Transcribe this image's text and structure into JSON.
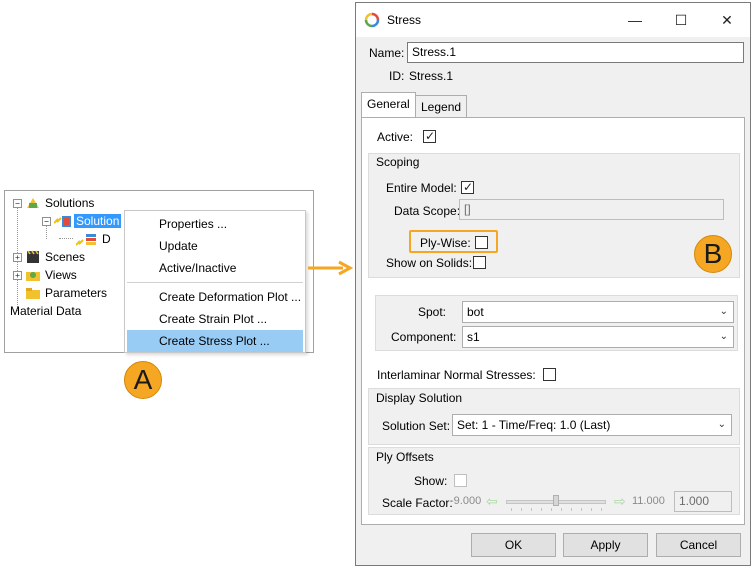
{
  "tree": {
    "items": [
      {
        "label": "Solutions",
        "icon": "solutions-icon"
      },
      {
        "label": "Solution",
        "icon": "solution-icon"
      },
      {
        "label": "D",
        "icon": "deformation-icon"
      },
      {
        "label": "Scenes",
        "icon": "scenes-icon"
      },
      {
        "label": "Views",
        "icon": "views-icon"
      },
      {
        "label": "Parameters",
        "icon": "parameters-icon"
      },
      {
        "label": "Material Data"
      }
    ]
  },
  "context_menu": {
    "items": [
      "Properties ...",
      "Update",
      "Active/Inactive",
      "Create Deformation Plot ...",
      "Create Strain Plot ...",
      "Create Stress Plot ..."
    ]
  },
  "callouts": {
    "a": "A",
    "b": "B"
  },
  "dialog": {
    "title": "Stress",
    "title_icon": "stress-app-icon",
    "window_controls": {
      "minimize": "—",
      "maximize": "☐",
      "close": "✕"
    },
    "name_label": "Name:",
    "name_value": "Stress.1",
    "id_label": "ID:",
    "id_value": "Stress.1",
    "tabs": [
      "General",
      "Legend"
    ],
    "active_label": "Active:",
    "active_checked": true,
    "scoping": {
      "title": "Scoping",
      "entire_model_label": "Entire Model:",
      "entire_model_checked": true,
      "data_scope_label": "Data Scope:",
      "data_scope_value": "[]",
      "ply_wise_label": "Ply-Wise:",
      "ply_wise_checked": false,
      "show_on_solids_label": "Show on Solids:",
      "show_on_solids_checked": false
    },
    "spot_label": "Spot:",
    "spot_value": "bot",
    "component_label": "Component:",
    "component_value": "s1",
    "interlaminar_label": "Interlaminar Normal Stresses:",
    "interlaminar_checked": false,
    "display_solution": {
      "title": "Display Solution",
      "solution_set_label": "Solution Set:",
      "solution_set_value": "Set: 1 - Time/Freq: 1.0 (Last)"
    },
    "ply_offsets": {
      "title": "Ply Offsets",
      "show_label": "Show:",
      "scale_factor_label": "Scale Factor:",
      "min_value": "-9.000",
      "max_value": "11.000",
      "current_value": "1.000",
      "slider_fraction": 0.5
    },
    "buttons": {
      "ok": "OK",
      "apply": "Apply",
      "cancel": "Cancel"
    }
  },
  "colors": {
    "callout": "#f5a623",
    "menu_highlight": "#99ccf5",
    "selection": "#3399ff"
  }
}
